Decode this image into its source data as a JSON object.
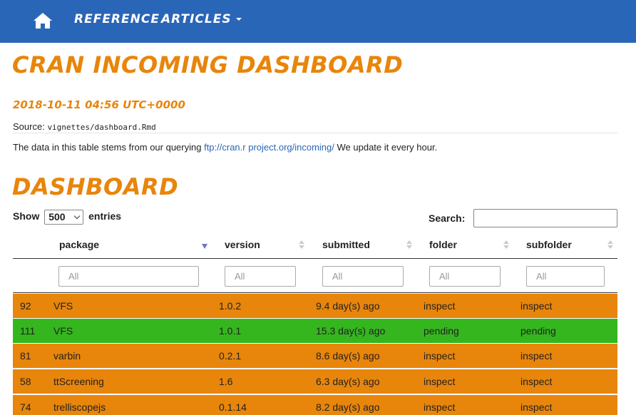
{
  "nav": {
    "home_icon": "home-icon",
    "reference": "REFERENCE",
    "articles": "ARTICLES"
  },
  "page": {
    "title": "CRAN INCOMING DASHBOARD",
    "date": "2018-10-11 04:56 UTC+0000",
    "source_label": "Source:",
    "source_path": "vignettes/dashboard.Rmd",
    "intro_before": "The data in this table stems from our querying ",
    "intro_link": "ftp://cran.r project.org/incoming/",
    "intro_after": " We update it every hour.",
    "section_title": "DASHBOARD"
  },
  "controls": {
    "show_label": "Show",
    "entries_value": "500",
    "entries_label": "entries",
    "search_label": "Search:",
    "search_value": ""
  },
  "table": {
    "columns": [
      "package",
      "version",
      "submitted",
      "folder",
      "subfolder"
    ],
    "sorted_column": "package",
    "filter_placeholder": "All",
    "rows": [
      {
        "id": "92",
        "package": "VFS",
        "version": "1.0.2",
        "submitted": "9.4 day(s) ago",
        "folder": "inspect",
        "subfolder": "inspect",
        "color": "#e8850b"
      },
      {
        "id": "111",
        "package": "VFS",
        "version": "1.0.1",
        "submitted": "15.3 day(s) ago",
        "folder": "pending",
        "subfolder": "pending",
        "color": "#35b61e"
      },
      {
        "id": "81",
        "package": "varbin",
        "version": "0.2.1",
        "submitted": "8.6 day(s) ago",
        "folder": "inspect",
        "subfolder": "inspect",
        "color": "#e8850b"
      },
      {
        "id": "58",
        "package": "ttScreening",
        "version": "1.6",
        "submitted": "6.3 day(s) ago",
        "folder": "inspect",
        "subfolder": "inspect",
        "color": "#e8850b"
      },
      {
        "id": "74",
        "package": "trelliscopejs",
        "version": "0.1.14",
        "submitted": "8.2 day(s) ago",
        "folder": "inspect",
        "subfolder": "inspect",
        "color": "#e8850b"
      }
    ]
  }
}
